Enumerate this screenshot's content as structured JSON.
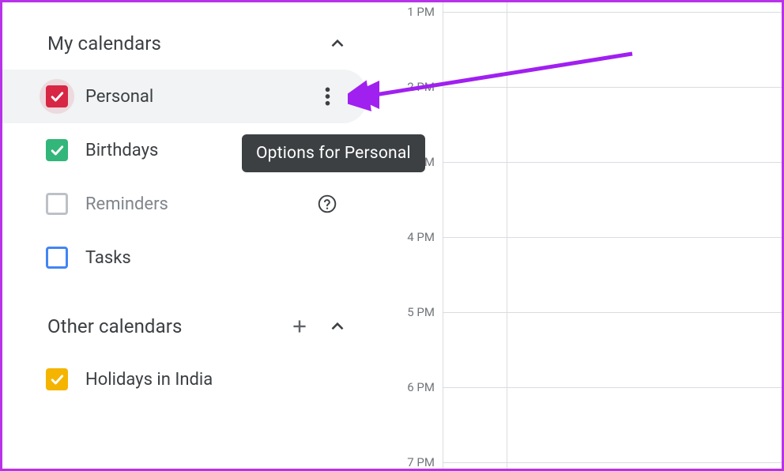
{
  "sections": {
    "my_calendars": {
      "title": "My calendars"
    },
    "other_calendars": {
      "title": "Other calendars"
    }
  },
  "calendars": {
    "personal": {
      "label": "Personal"
    },
    "birthdays": {
      "label": "Birthdays"
    },
    "reminders": {
      "label": "Reminders"
    },
    "tasks": {
      "label": "Tasks"
    },
    "holidays": {
      "label": "Holidays in India"
    }
  },
  "tooltip": "Options for Personal",
  "times": {
    "t1": "1 PM",
    "t2": "2 PM",
    "t3": "3 PM",
    "t4": "4 PM",
    "t5": "5 PM",
    "t6": "6 PM",
    "t7": "7 PM"
  },
  "colors": {
    "personal": "#d72744",
    "birthdays": "#33b679",
    "tasks": "#4285f4",
    "holidays": "#f4b400",
    "arrow": "#a020f0"
  }
}
